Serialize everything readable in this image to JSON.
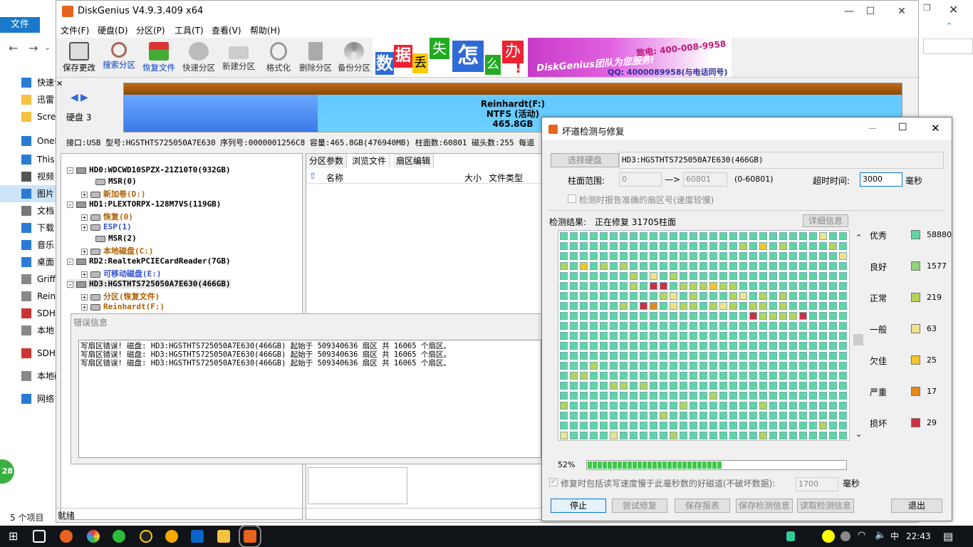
{
  "explorer": {
    "file_tab": "文件",
    "nav_items": [
      {
        "label": "快速访",
        "icon": "star-icon"
      },
      {
        "label": "迅雷",
        "icon": "folder-icon"
      },
      {
        "label": "Scre",
        "icon": "folder-icon"
      },
      {
        "label": "OneD",
        "icon": "cloud-icon"
      },
      {
        "label": "This P",
        "icon": "computer-icon"
      },
      {
        "label": "视频",
        "icon": "video-icon"
      },
      {
        "label": "图片",
        "icon": "pictures-icon"
      },
      {
        "label": "文档",
        "icon": "documents-icon"
      },
      {
        "label": "下载",
        "icon": "download-icon"
      },
      {
        "label": "音乐",
        "icon": "music-icon"
      },
      {
        "label": "桌面",
        "icon": "desktop-icon"
      },
      {
        "label": "Griff",
        "icon": "drive-icon"
      },
      {
        "label": "Rein",
        "icon": "drive-icon"
      },
      {
        "label": "SDH",
        "icon": "sd-icon"
      },
      {
        "label": "本地",
        "icon": "drive-icon"
      },
      {
        "label": "SDHC",
        "icon": "sd-icon"
      },
      {
        "label": "本地磁",
        "icon": "drive-icon"
      },
      {
        "label": "网络",
        "icon": "network-icon"
      }
    ],
    "status": "5 个项目",
    "badge": "28"
  },
  "diskgenius": {
    "title": "DiskGenius V4.9.3.409 x64",
    "menu": [
      "文件(F)",
      "硬盘(D)",
      "分区(P)",
      "工具(T)",
      "查看(V)",
      "帮助(H)"
    ],
    "toolbar": [
      {
        "label": "保存更改",
        "icon": "save-icon"
      },
      {
        "label": "搜索分区",
        "icon": "search-partition-icon"
      },
      {
        "label": "恢复文件",
        "icon": "recover-file-icon"
      },
      {
        "label": "快速分区",
        "icon": "quick-partition-icon"
      },
      {
        "label": "新建分区",
        "icon": "new-partition-icon"
      },
      {
        "label": "格式化",
        "icon": "format-icon"
      },
      {
        "label": "删除分区",
        "icon": "delete-partition-icon"
      },
      {
        "label": "备份分区",
        "icon": "backup-partition-icon"
      }
    ],
    "banner": {
      "chars": [
        "数",
        "据",
        "丢",
        "失",
        "怎",
        "么",
        "办",
        "!"
      ],
      "team_text": "DiskGenius团队为您服务!",
      "phone": "致电: 400-008-9958",
      "qq": "QQ: 4000089958(与电话同号)"
    },
    "disk_label": "硬盘 3",
    "partition": {
      "name": "Reinhardt(F:)",
      "fs": "NTFS (活动)",
      "size": "465.8GB"
    },
    "disk_info": "接口:USB  型号:HGSTHTS725050A7E630  序列号:0000001256C8  容量:465.8GB(476940MB)  柱面数:60801  磁头数:255  每道",
    "tree": [
      {
        "text": "HD0:WDCWD10SPZX-21Z10T0(932GB)",
        "level": 0,
        "color": "#000",
        "kind": "disk",
        "exp": "-"
      },
      {
        "text": "MSR(0)",
        "level": 2,
        "color": "#000",
        "kind": "part",
        "exp": ""
      },
      {
        "text": "新加卷(D:)",
        "level": 1,
        "color": "#b06000",
        "kind": "part",
        "exp": "+"
      },
      {
        "text": "HD1:PLEXTORPX-128M7VS(119GB)",
        "level": 0,
        "color": "#000",
        "kind": "disk",
        "exp": "-"
      },
      {
        "text": "恢复(0)",
        "level": 1,
        "color": "#b06000",
        "kind": "part",
        "exp": "+"
      },
      {
        "text": "ESP(1)",
        "level": 1,
        "color": "#3050d0",
        "kind": "part",
        "exp": "+"
      },
      {
        "text": "MSR(2)",
        "level": 2,
        "color": "#000",
        "kind": "part",
        "exp": ""
      },
      {
        "text": "本地磁盘(C:)",
        "level": 1,
        "color": "#b06000",
        "kind": "part",
        "exp": "+"
      },
      {
        "text": "RD2:RealtekPCIECardReader(7GB)",
        "level": 0,
        "color": "#000",
        "kind": "disk",
        "exp": "-"
      },
      {
        "text": "可移动磁盘(E:)",
        "level": 1,
        "color": "#3050d0",
        "kind": "part",
        "exp": "+"
      },
      {
        "text": "HD3:HGSTHTS725050A7E630(466GB)",
        "level": 0,
        "color": "#000",
        "kind": "disk",
        "exp": "-"
      },
      {
        "text": "分区(恢复文件)",
        "level": 1,
        "color": "#b06000",
        "kind": "part",
        "exp": "+"
      },
      {
        "text": "Reinhardt(F:)",
        "level": 1,
        "color": "#b06000",
        "kind": "part",
        "exp": "+"
      }
    ],
    "tabs": [
      "分区参数",
      "浏览文件",
      "扇区编辑"
    ],
    "columns": [
      "名称",
      "大小",
      "文件类型"
    ],
    "status": "就绪"
  },
  "error_panel": {
    "title": "错误信息",
    "lines": [
      "写扇区错误! 磁盘: HD3:HGSTHTS725050A7E630(466GB) 起始于 509340636 扇区 共 16065 个扇区。",
      "写扇区错误! 磁盘: HD3:HGSTHTS725050A7E630(466GB) 起始于 509340636 扇区 共 16065 个扇区。",
      "写扇区错误! 磁盘: HD3:HGSTHTS725050A7E630(466GB) 起始于 509340636 扇区 共 16065 个扇区。"
    ]
  },
  "badsector": {
    "title": "坏道检测与修复",
    "select_disk": "选择硬盘",
    "disk_name": "HD3:HGSTHTS725050A7E630(466GB)",
    "cyl_range_label": "柱面范围:",
    "cyl_from": "0",
    "arrow": "—>",
    "cyl_to": "60801",
    "cyl_hint": "(0-60801)",
    "timeout_label": "超时时间:",
    "timeout_value": "3000",
    "ms": "毫秒",
    "report_sector": "检测时报告准确的扇区号(速度较慢)",
    "result_label": "检测结果:",
    "result_status": "正在修复 31705柱面",
    "detail": "详细信息",
    "progress_text": "52%",
    "progress": 0.52,
    "repair_option": "修复时包括读写速度慢于此毫秒数的好磁道(不破坏数据):",
    "repair_ms": "1700",
    "buttons": [
      "停止",
      "尝试修复",
      "保存报表",
      "保存检测信息",
      "读取检测信息",
      "退出"
    ],
    "legend": [
      {
        "label": "优秀",
        "count": "58880",
        "color": "#5fd5a4"
      },
      {
        "label": "良好",
        "count": "1577",
        "color": "#8fd27a"
      },
      {
        "label": "正常",
        "count": "219",
        "color": "#b6d35a"
      },
      {
        "label": "一般",
        "count": "63",
        "color": "#f2e28a"
      },
      {
        "label": "欠佳",
        "count": "25",
        "color": "#f5c52a"
      },
      {
        "label": "严重",
        "count": "17",
        "color": "#e48a1e"
      },
      {
        "label": "损坏",
        "count": "29",
        "color": "#cc3040"
      }
    ]
  },
  "taskbar": {
    "lang": "中",
    "time": "22:43"
  }
}
